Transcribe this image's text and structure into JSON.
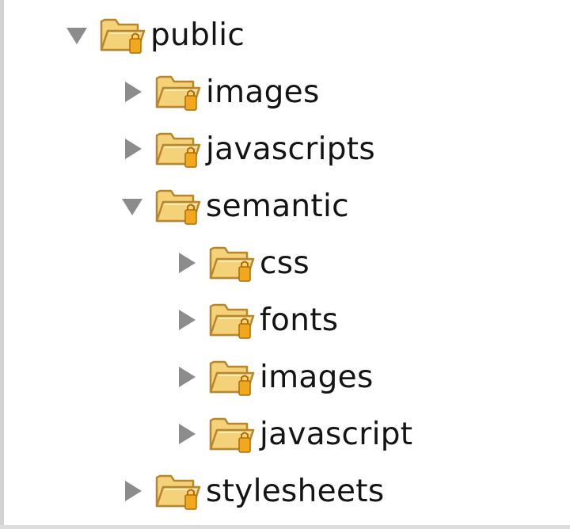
{
  "tree": {
    "items": [
      {
        "label": "public",
        "expanded": true,
        "depth": 0,
        "icon": "folder-icon"
      },
      {
        "label": "images",
        "expanded": false,
        "depth": 1,
        "icon": "folder-icon"
      },
      {
        "label": "javascripts",
        "expanded": false,
        "depth": 1,
        "icon": "folder-icon"
      },
      {
        "label": "semantic",
        "expanded": true,
        "depth": 1,
        "icon": "folder-icon"
      },
      {
        "label": "css",
        "expanded": false,
        "depth": 2,
        "icon": "folder-icon"
      },
      {
        "label": "fonts",
        "expanded": false,
        "depth": 2,
        "icon": "folder-icon"
      },
      {
        "label": "images",
        "expanded": false,
        "depth": 2,
        "icon": "folder-icon"
      },
      {
        "label": "javascript",
        "expanded": false,
        "depth": 2,
        "icon": "folder-icon"
      },
      {
        "label": "stylesheets",
        "expanded": false,
        "depth": 1,
        "icon": "folder-icon"
      }
    ]
  },
  "colors": {
    "folder_fill": "#f3d27a",
    "folder_outline": "#b8862c",
    "lock_badge": "#f2a81d",
    "disclosure_triangle": "#8c8c8c",
    "label_text": "#141414"
  }
}
